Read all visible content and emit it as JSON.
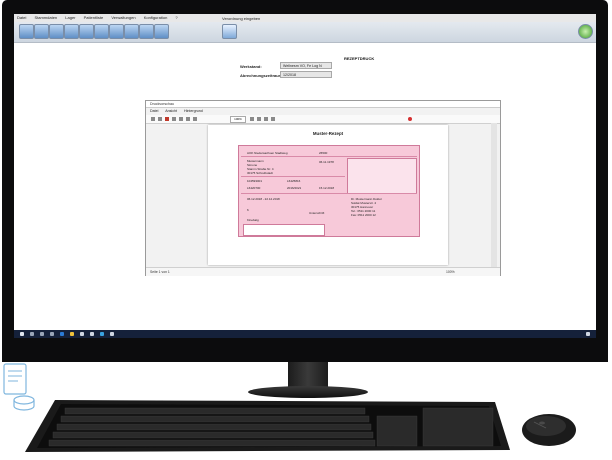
{
  "menubar": {
    "items": [
      "Datei",
      "Stammdaten",
      "Lager",
      "Patientliste",
      "Verwaltungen",
      "Konfiguration",
      "?"
    ]
  },
  "toolbar": {
    "window_label": "Verordnung eingeben",
    "icons": [
      "patient-icon",
      "prescription-icon",
      "stock-icon",
      "list-icon",
      "calendar-icon",
      "invoice-icon",
      "chart-icon",
      "print-icon",
      "settings-icon",
      "tools-icon"
    ]
  },
  "app": {
    "heading": "REZEPTDRUCK",
    "fields": [
      {
        "label": "Werkstand:",
        "value": "Wellnesm VO, Fe Log N"
      },
      {
        "label": "Abrechnungszeitraum:",
        "value": "12/2018"
      }
    ]
  },
  "viewer": {
    "title": "Druckvorschau",
    "menu": [
      "Datei",
      "Ansicht",
      "Hintergrund"
    ],
    "zoom": "100%",
    "page_indicator": "Seite 1 von 1",
    "zoom_status": "100%",
    "doc_title": "Muster-Rezept"
  },
  "form": {
    "insurer": "AOK Niedersachsen Stadtweg",
    "insurer_code": "26500",
    "patient_name": "Mustermann",
    "patient_first": "Simone",
    "street": "Stamm Straße Nr. 4",
    "city": "30175 Schreibstadt",
    "birth_date": "06.11.1978",
    "id_1": "104593001",
    "id_2": "L6425816",
    "id_3": "L6420700",
    "id_4": "2016/2021",
    "date": "15.12.2018",
    "practitioner": "Dr. Mustermann Doktor",
    "practice_street": "Soldat Musterstr. 4",
    "practice_city": "30175 Hannover",
    "phone": "Tel.: 0511 2000 11",
    "fax": "Fax: 0511 2000 12",
    "period": "06.12.2018 - 22.12.2018",
    "count": "6",
    "therapy": "Kinebalg",
    "signature": "Unterschrift"
  },
  "colors": {
    "form_pink": "#f7c9d9",
    "monitor_black": "#0c0c0d",
    "taskbar": "#15213a"
  }
}
